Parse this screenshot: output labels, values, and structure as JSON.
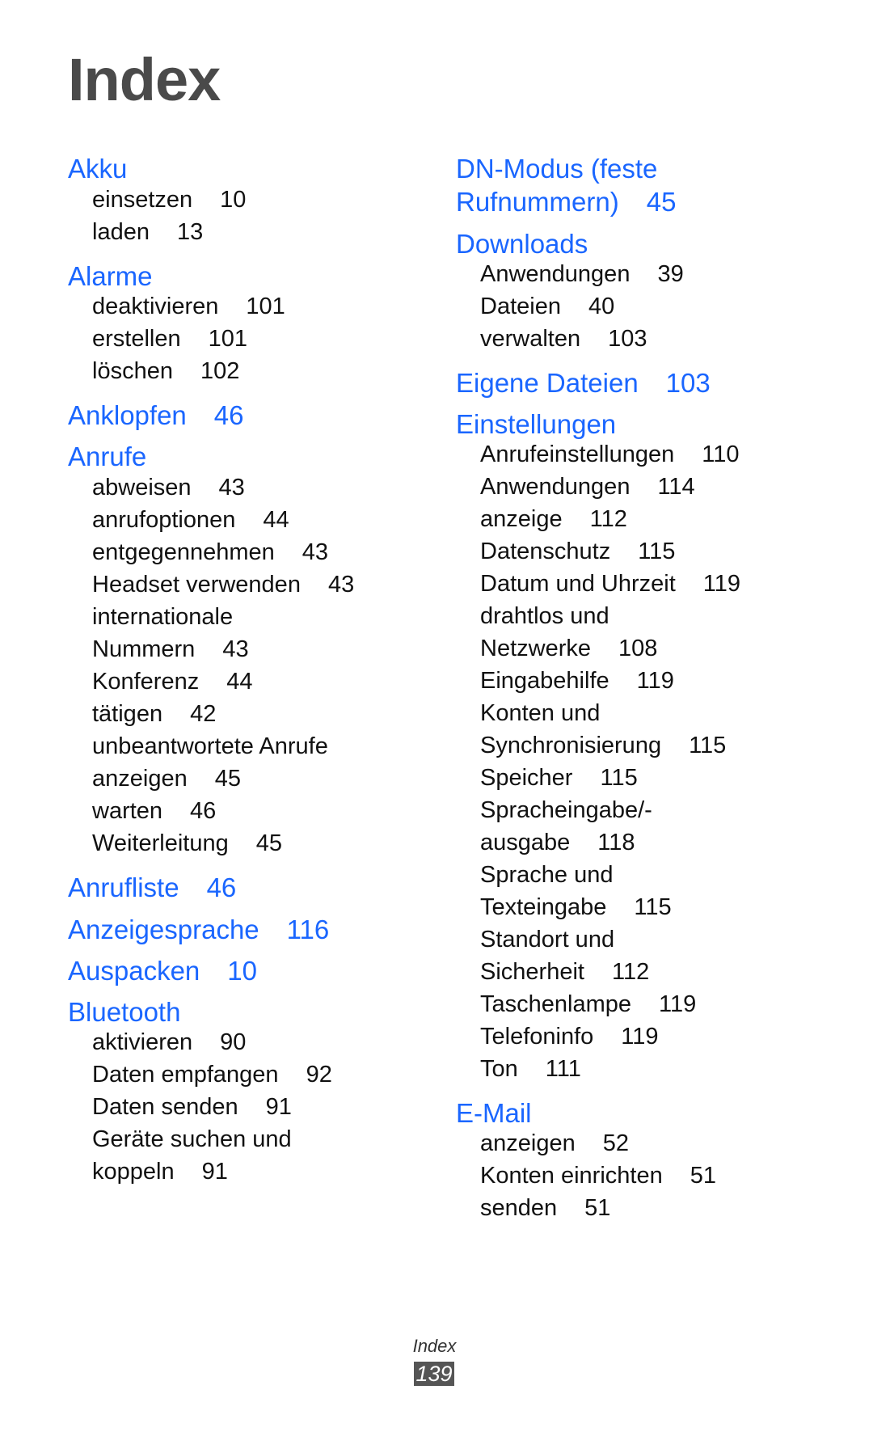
{
  "page_title": "Index",
  "footer": {
    "label": "Index",
    "page_number": "139"
  },
  "colors": {
    "heading": "#1a66ff",
    "text": "#111111",
    "title": "#4a4a4a",
    "page_badge": "#555555"
  },
  "left_column": [
    {
      "type": "head",
      "text": "Akku",
      "page": ""
    },
    {
      "type": "sub",
      "text": "einsetzen",
      "page": "10"
    },
    {
      "type": "sub",
      "text": "laden",
      "page": "13"
    },
    {
      "type": "head",
      "text": "Alarme",
      "page": ""
    },
    {
      "type": "sub",
      "text": "deaktivieren",
      "page": "101"
    },
    {
      "type": "sub",
      "text": "erstellen",
      "page": "101"
    },
    {
      "type": "sub",
      "text": "löschen",
      "page": "102"
    },
    {
      "type": "head",
      "text": "Anklopfen",
      "page": "46"
    },
    {
      "type": "head",
      "text": "Anrufe",
      "page": ""
    },
    {
      "type": "sub",
      "text": "abweisen",
      "page": "43"
    },
    {
      "type": "sub",
      "text": "anrufoptionen",
      "page": "44"
    },
    {
      "type": "sub",
      "text": "entgegennehmen",
      "page": "43"
    },
    {
      "type": "sub",
      "text": "Headset verwenden",
      "page": "43"
    },
    {
      "type": "sub",
      "text": "internationale",
      "page": ""
    },
    {
      "type": "sub",
      "text": "Nummern",
      "page": "43"
    },
    {
      "type": "sub",
      "text": "Konferenz",
      "page": "44"
    },
    {
      "type": "sub",
      "text": "tätigen",
      "page": "42"
    },
    {
      "type": "sub",
      "text": "unbeantwortete Anrufe",
      "page": ""
    },
    {
      "type": "sub",
      "text": "anzeigen",
      "page": "45"
    },
    {
      "type": "sub",
      "text": "warten",
      "page": "46"
    },
    {
      "type": "sub",
      "text": "Weiterleitung",
      "page": "45"
    },
    {
      "type": "head",
      "text": "Anrufliste",
      "page": "46"
    },
    {
      "type": "head",
      "text": "Anzeigesprache",
      "page": "116"
    },
    {
      "type": "head",
      "text": "Auspacken",
      "page": "10"
    },
    {
      "type": "head",
      "text": "Bluetooth",
      "page": ""
    },
    {
      "type": "sub",
      "text": "aktivieren",
      "page": "90"
    },
    {
      "type": "sub",
      "text": "Daten empfangen",
      "page": "92"
    },
    {
      "type": "sub",
      "text": "Daten senden",
      "page": "91"
    },
    {
      "type": "sub",
      "text": "Geräte suchen und",
      "page": ""
    },
    {
      "type": "sub",
      "text": "koppeln",
      "page": "91"
    }
  ],
  "right_column": [
    {
      "type": "head",
      "text": "DN-Modus (feste",
      "page": ""
    },
    {
      "type": "head",
      "text": "Rufnummern)",
      "page": "45"
    },
    {
      "type": "head",
      "text": "Downloads",
      "page": ""
    },
    {
      "type": "sub",
      "text": "Anwendungen",
      "page": "39"
    },
    {
      "type": "sub",
      "text": "Dateien",
      "page": "40"
    },
    {
      "type": "sub",
      "text": "verwalten",
      "page": "103"
    },
    {
      "type": "head",
      "text": "Eigene Dateien",
      "page": "103"
    },
    {
      "type": "head",
      "text": "Einstellungen",
      "page": ""
    },
    {
      "type": "sub",
      "text": "Anrufeinstellungen",
      "page": "110"
    },
    {
      "type": "sub",
      "text": "Anwendungen",
      "page": "114"
    },
    {
      "type": "sub",
      "text": "anzeige",
      "page": "112"
    },
    {
      "type": "sub",
      "text": "Datenschutz",
      "page": "115"
    },
    {
      "type": "sub",
      "text": "Datum und Uhrzeit",
      "page": "119"
    },
    {
      "type": "sub",
      "text": "drahtlos und",
      "page": ""
    },
    {
      "type": "sub",
      "text": "Netzwerke",
      "page": "108"
    },
    {
      "type": "sub",
      "text": "Eingabehilfe",
      "page": "119"
    },
    {
      "type": "sub",
      "text": "Konten und",
      "page": ""
    },
    {
      "type": "sub",
      "text": "Synchronisierung",
      "page": "115"
    },
    {
      "type": "sub",
      "text": "Speicher",
      "page": "115"
    },
    {
      "type": "sub",
      "text": "Spracheingabe/-",
      "page": ""
    },
    {
      "type": "sub",
      "text": "ausgabe",
      "page": "118"
    },
    {
      "type": "sub",
      "text": "Sprache und",
      "page": ""
    },
    {
      "type": "sub",
      "text": "Texteingabe",
      "page": "115"
    },
    {
      "type": "sub",
      "text": "Standort und",
      "page": ""
    },
    {
      "type": "sub",
      "text": "Sicherheit",
      "page": "112"
    },
    {
      "type": "sub",
      "text": "Taschenlampe",
      "page": "119"
    },
    {
      "type": "sub",
      "text": "Telefoninfo",
      "page": "119"
    },
    {
      "type": "sub",
      "text": "Ton",
      "page": "111"
    },
    {
      "type": "head",
      "text": "E-Mail",
      "page": ""
    },
    {
      "type": "sub",
      "text": "anzeigen",
      "page": "52"
    },
    {
      "type": "sub",
      "text": "Konten einrichten",
      "page": "51"
    },
    {
      "type": "sub",
      "text": "senden",
      "page": "51"
    }
  ]
}
